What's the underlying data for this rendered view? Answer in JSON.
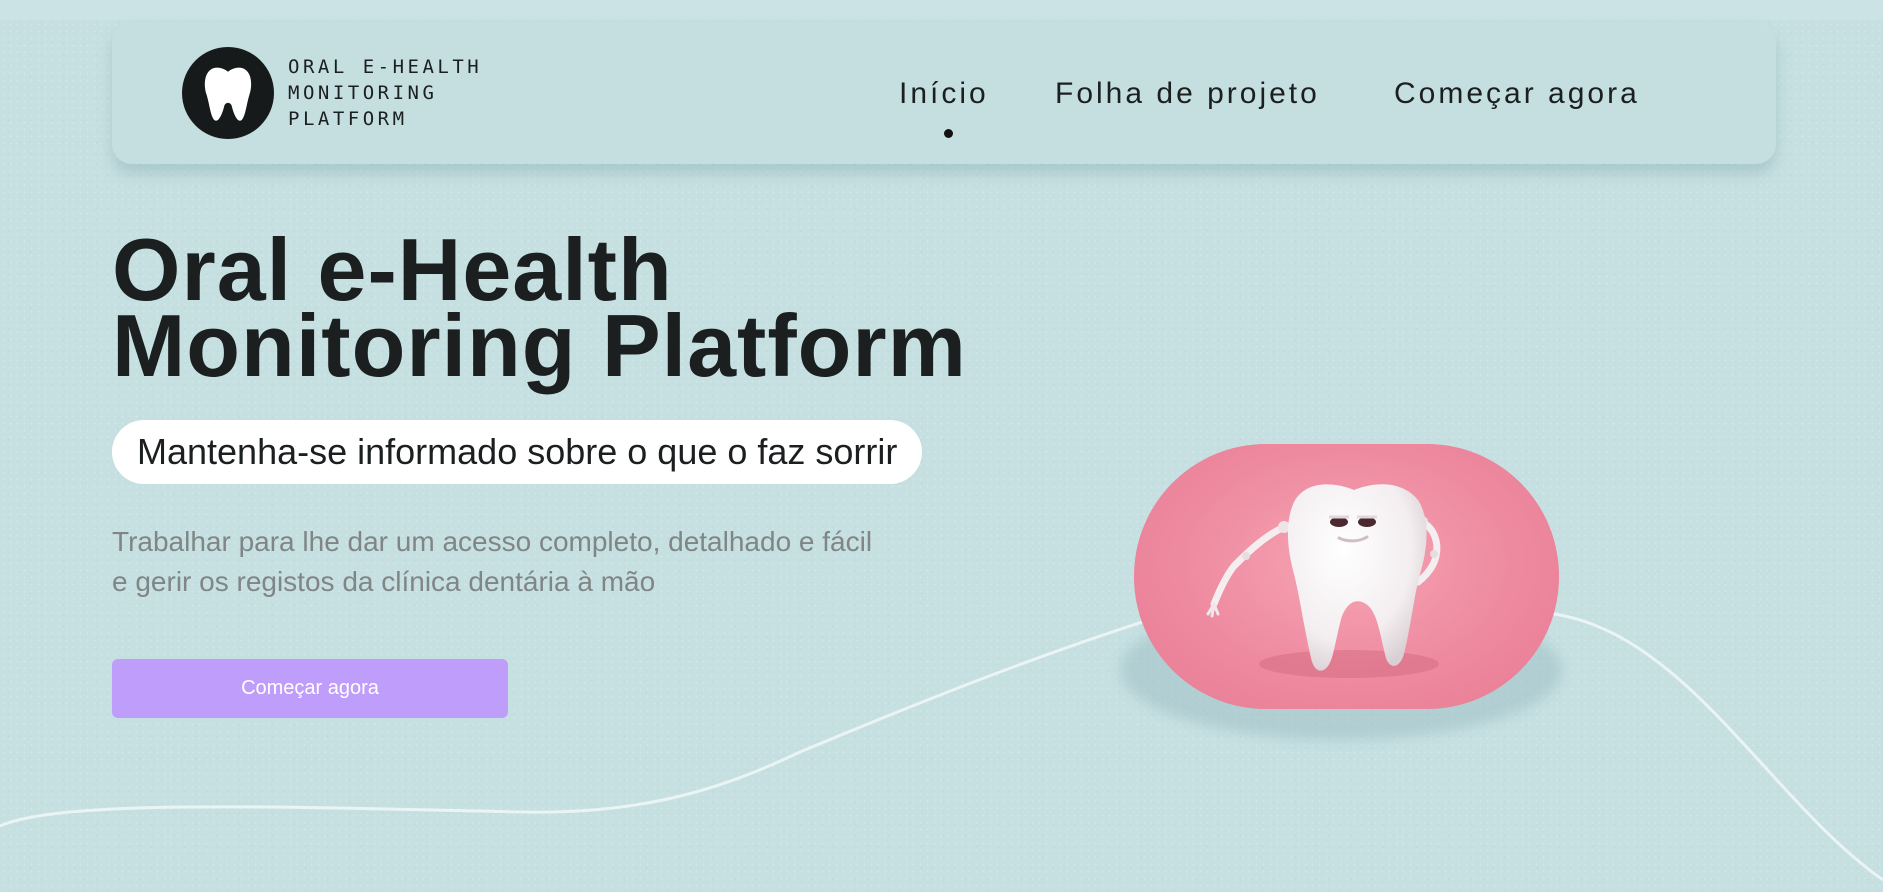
{
  "header": {
    "logo": {
      "icon": "tooth-icon",
      "text": "ORAL E-HEALTH MONITORING PLATFORM"
    },
    "nav": [
      {
        "label": "Início",
        "active": true
      },
      {
        "label": "Folha de projeto",
        "active": false
      },
      {
        "label": "Começar agora",
        "active": false
      }
    ]
  },
  "hero": {
    "title_line1": "Oral e-Health",
    "title_line2": "Monitoring Platform",
    "tagline": "Mantenha-se informado sobre o que o faz sorrir",
    "description": "Trabalhar para lhe dar um acesso completo, detalhado e fácil e gerir os registos da clínica dentária à mão",
    "cta_label": "Começar agora",
    "image_icon": "cartoon-tooth-illustration"
  },
  "colors": {
    "background": "#c6e0e2",
    "header_bg": "#c5dfe1",
    "text": "#1b1f20",
    "muted_text": "#808586",
    "cta": "#bf9dfa",
    "image_bg": "#ee8aa0",
    "wave": "#eef6f7"
  }
}
